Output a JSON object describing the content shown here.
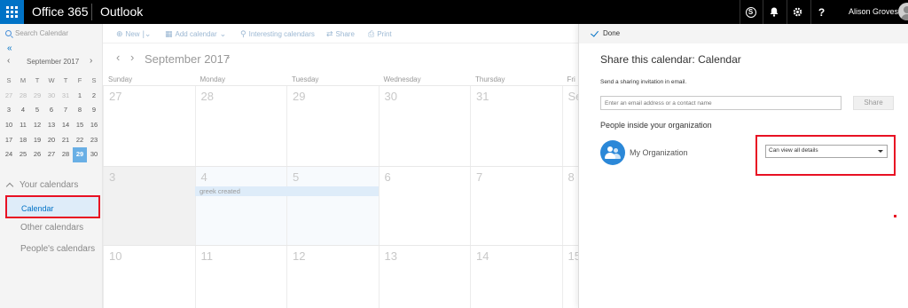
{
  "topbar": {
    "brand": "Office 365",
    "app": "Outlook",
    "user_name": "Alison Groves",
    "icons": [
      "skype-icon",
      "bell-icon",
      "gear-icon",
      "help-icon"
    ]
  },
  "sidebar": {
    "search_placeholder": "Search Calendar",
    "mini_calendar": {
      "month_label": "September 2017",
      "weekday_heads": [
        "S",
        "M",
        "T",
        "W",
        "T",
        "F",
        "S"
      ],
      "weeks": [
        [
          27,
          28,
          29,
          30,
          31,
          1,
          2
        ],
        [
          3,
          4,
          5,
          6,
          7,
          8,
          9
        ],
        [
          10,
          11,
          12,
          13,
          14,
          15,
          16
        ],
        [
          17,
          18,
          19,
          20,
          21,
          22,
          23
        ],
        [
          24,
          25,
          26,
          27,
          28,
          29,
          30
        ]
      ],
      "selected_day": 29
    },
    "your_calendars_label": "Your calendars",
    "calendar_item": "Calendar",
    "other_calendars_label": "Other calendars",
    "people_calendars_label": "People's calendars"
  },
  "toolbar": {
    "new_label": "New",
    "add_calendar_label": "Add calendar",
    "interesting_label": "Interesting calendars",
    "share_label": "Share",
    "print_label": "Print"
  },
  "calendar": {
    "month_title": "September 2017",
    "day_headers": [
      "Sunday",
      "Monday",
      "Tuesday",
      "Wednesday",
      "Thursday",
      "Fri"
    ],
    "weeks": [
      [
        "27",
        "28",
        "29",
        "30",
        "31",
        "Se"
      ],
      [
        "3",
        "4",
        "5",
        "6",
        "7",
        "8"
      ],
      [
        "10",
        "11",
        "12",
        "13",
        "14",
        "15"
      ]
    ],
    "event_title": "greek created"
  },
  "share_panel": {
    "done_label": "Done",
    "title": "Share this calendar: Calendar",
    "invite_label": "Send a sharing invitation in email.",
    "invite_placeholder": "Enter an email address or a contact name",
    "share_button": "Share",
    "people_heading": "People inside your organization",
    "org_name": "My Organization",
    "permission_value": "Can view all details"
  },
  "colors": {
    "accent": "#0072c6",
    "highlight": "#e81123",
    "today": "#69afe5",
    "event_bg": "#deecf9"
  }
}
